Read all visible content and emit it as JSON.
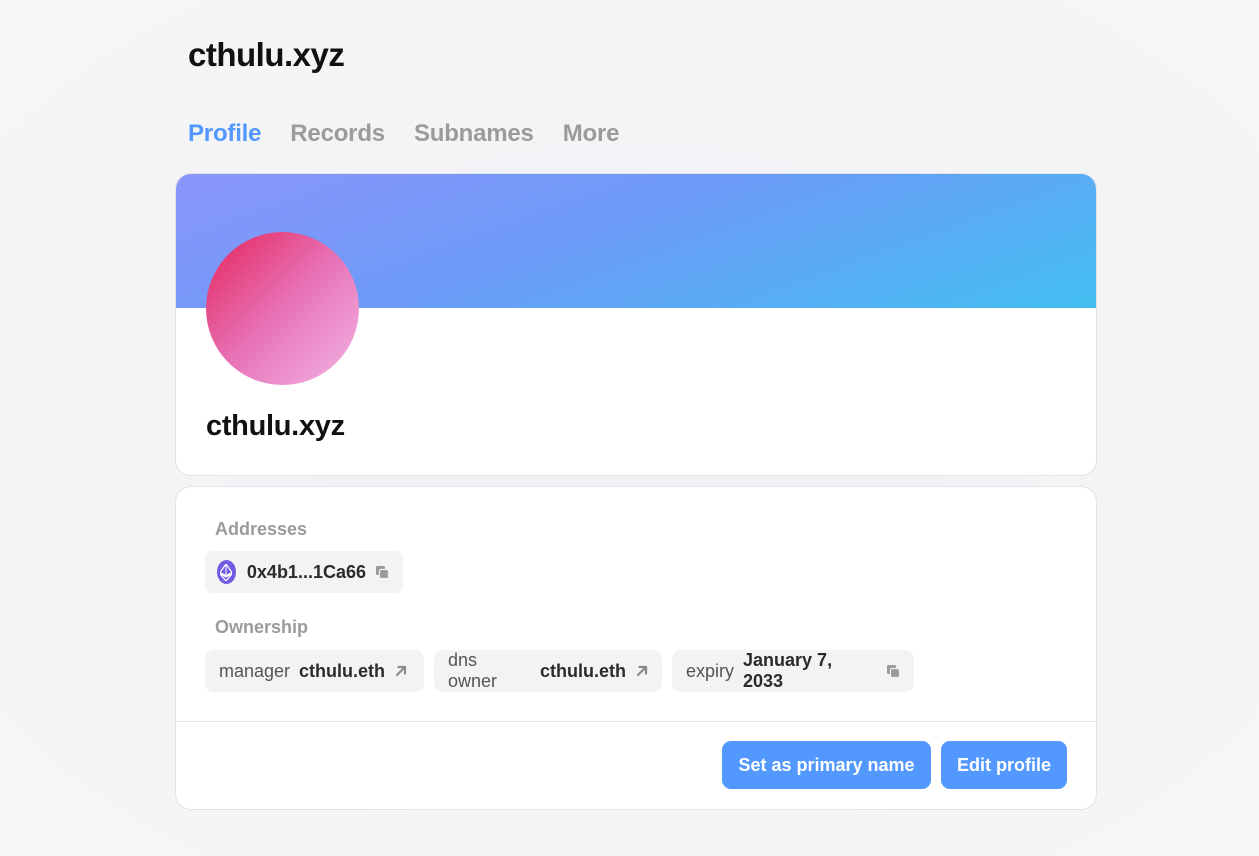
{
  "header": {
    "title": "cthulu.xyz"
  },
  "tabs": [
    {
      "label": "Profile",
      "active": true
    },
    {
      "label": "Records",
      "active": false
    },
    {
      "label": "Subnames",
      "active": false
    },
    {
      "label": "More",
      "active": false
    }
  ],
  "profile": {
    "name": "cthulu.xyz"
  },
  "addresses": {
    "label": "Addresses",
    "items": [
      {
        "value": "0x4b1...1Ca66",
        "icon": "eth-icon",
        "action_icon": "copy-icon"
      }
    ]
  },
  "ownership": {
    "label": "Ownership",
    "items": [
      {
        "key": "manager",
        "value": "cthulu.eth",
        "action_icon": "external-link-icon"
      },
      {
        "key": "dns owner",
        "value": "cthulu.eth",
        "action_icon": "external-link-icon"
      },
      {
        "key": "expiry",
        "value": "January 7, 2033",
        "action_icon": "copy-icon"
      }
    ]
  },
  "actions": {
    "primary_label": "Set as primary name",
    "edit_label": "Edit profile"
  },
  "colors": {
    "accent": "#5298ff",
    "banner_start": "#8a95fb",
    "banner_end": "#43bff1",
    "avatar_start": "#e5245a",
    "avatar_end": "#f3b6e6",
    "eth": "#6f5ce2"
  }
}
